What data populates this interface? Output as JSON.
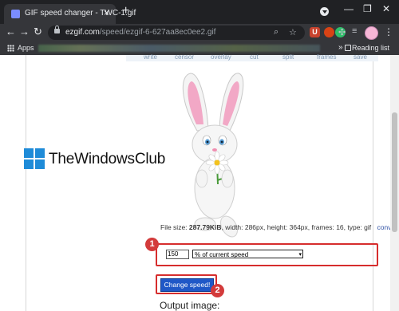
{
  "browser": {
    "tab_title": "GIF speed changer - TWC-1.gif",
    "tab_close": "×",
    "new_tab": "+",
    "window_minimize": "—",
    "window_restore": "❐",
    "window_close": "✕",
    "nav_back": "←",
    "nav_forward": "→",
    "nav_reload": "↻",
    "url_host": "ezgif.com",
    "url_path": "/speed/ezgif-6-627aa8ec0ee2.gif",
    "extensions": [
      {
        "label": "U",
        "color": "#c8432e"
      },
      {
        "label": "",
        "color": "#d84315"
      },
      {
        "label": "",
        "color": "#2ebf6a"
      },
      {
        "label": "",
        "color": "#5f6368"
      },
      {
        "label": "",
        "color": "#5f6368"
      }
    ],
    "menu_dots": "⋮",
    "bookmarks": {
      "apps_label": "Apps",
      "more": "»",
      "reading_list": "Reading list"
    }
  },
  "page": {
    "menu_items": [
      "write",
      "censor",
      "overlay",
      "cut",
      "split",
      "frames",
      "save"
    ],
    "watermark_text": "TheWindowsClub",
    "file_info": {
      "label_size": "File size:",
      "size": "287.79KiB",
      "details": ", width: 286px, height: 364px, frames: 16, type: gif",
      "convert": "convert",
      "convert_icon": "▸"
    },
    "speed_value": "150",
    "speed_mode": "% of current speed",
    "speed_caret": "▾",
    "change_button": "Change speed!",
    "output_heading": "Output image:",
    "badges": [
      "1",
      "2"
    ]
  }
}
